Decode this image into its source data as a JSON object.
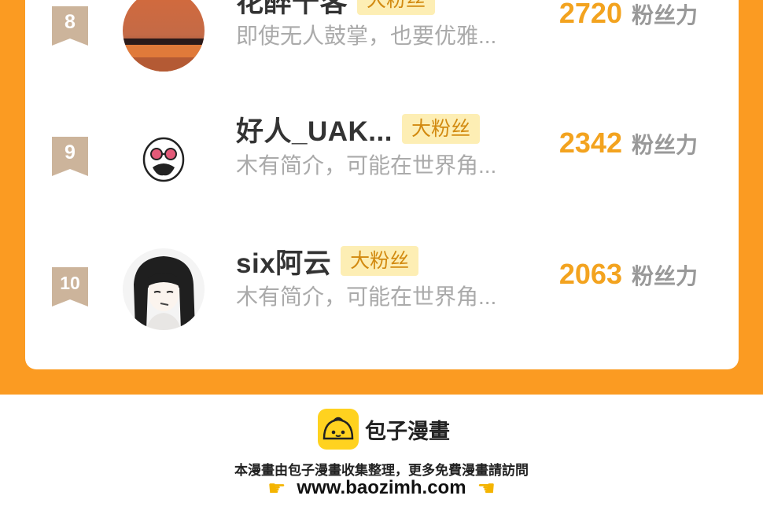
{
  "leaderboard": {
    "rows": [
      {
        "rank": "8",
        "name": "花醉千客",
        "badge": "大粉丝",
        "bio": "即使无人鼓掌，也要优雅...",
        "score": "2720",
        "unit": "粉丝力",
        "avatar_icon": "sunset-photo-avatar"
      },
      {
        "rank": "9",
        "name": "好人_UAK...",
        "badge": "大粉丝",
        "bio": "木有简介，可能在世界角...",
        "score": "2342",
        "unit": "粉丝力",
        "avatar_icon": "sunglasses-face-avatar"
      },
      {
        "rank": "10",
        "name": "six阿云",
        "badge": "大粉丝",
        "bio": "木有简介，可能在世界角...",
        "score": "2063",
        "unit": "粉丝力",
        "avatar_icon": "anime-girl-avatar"
      }
    ]
  },
  "footer": {
    "brand": "包子漫畫",
    "note": "本漫畫由包子漫畫收集整理，更多免費漫畫請訪問",
    "url": "www.baozimh.com",
    "hand_icon": "pointing-hand-icon"
  },
  "colors": {
    "accent": "#fb9b22",
    "score": "#f3a31f",
    "badge_bg": "#fdeeb4",
    "rank_flag": "#ccb49b"
  }
}
